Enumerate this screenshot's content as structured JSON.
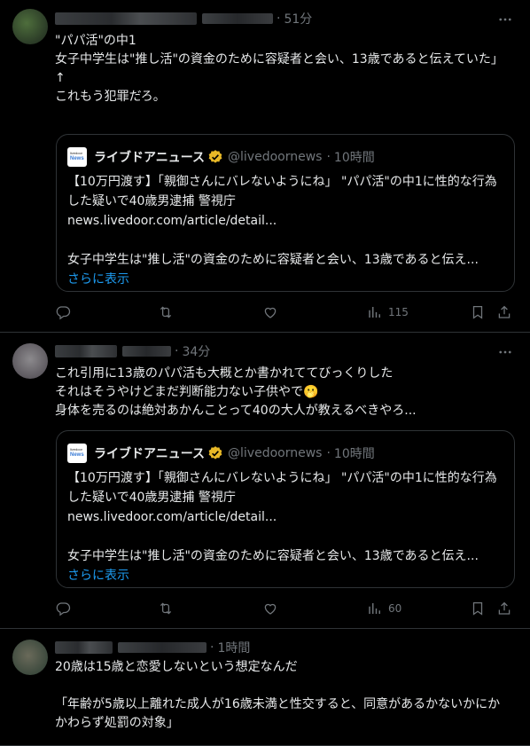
{
  "posts": [
    {
      "time": "51分",
      "text": "\"パパ活\"の中1\n女子中学生は\"推し活\"の資金のために容疑者と会い、13歳であると伝えていた」\n↑\nこれもう犯罪だろ。",
      "quote": {
        "logo_small": "livedoor",
        "logo_big": "News",
        "name": "ライブドアニュース",
        "handle": "@livedoornews",
        "time": "10時間",
        "body": "【10万円渡す】「親御さんにバレないようにね」 \"パパ活\"の中1に性的な行為した疑いで40歳男逮捕 警視庁\nnews.livedoor.com/article/detail...\n\n女子中学生は\"推し活\"の資金のために容疑者と会い、13歳であると伝え...",
        "show_more": "さらに表示"
      },
      "views": "115"
    },
    {
      "time": "34分",
      "text": "これ引用に13歳のパパ活も大概とか書かれててびっくりした\nそれはそうやけどまだ判断能力ない子供やで🫢\n身体を売るのは絶対あかんことって40の大人が教えるべきやろ...",
      "quote": {
        "logo_small": "livedoor",
        "logo_big": "News",
        "name": "ライブドアニュース",
        "handle": "@livedoornews",
        "time": "10時間",
        "body": "【10万円渡す】「親御さんにバレないようにね」 \"パパ活\"の中1に性的な行為した疑いで40歳男逮捕 警視庁\nnews.livedoor.com/article/detail...\n\n女子中学生は\"推し活\"の資金のために容疑者と会い、13歳であると伝え...",
        "show_more": "さらに表示"
      },
      "views": "60"
    },
    {
      "time": "1時間",
      "text": "20歳は15歳と恋愛しないという想定なんだ\n\n「年齢が5歳以上離れた成人が16歳未満と性交すると、同意があるかないかにかかわらず処罰の対象」"
    }
  ],
  "dot": "·",
  "colors": {
    "background": "#000000",
    "text": "#e7e9ea",
    "muted": "#71767b",
    "link": "#1d9bf0",
    "border": "#2f3336",
    "verified": "#e8b827"
  },
  "icons": [
    "more-icon",
    "reply-icon",
    "repost-icon",
    "like-icon",
    "views-icon",
    "bookmark-icon",
    "share-icon",
    "verified-badge-icon"
  ]
}
